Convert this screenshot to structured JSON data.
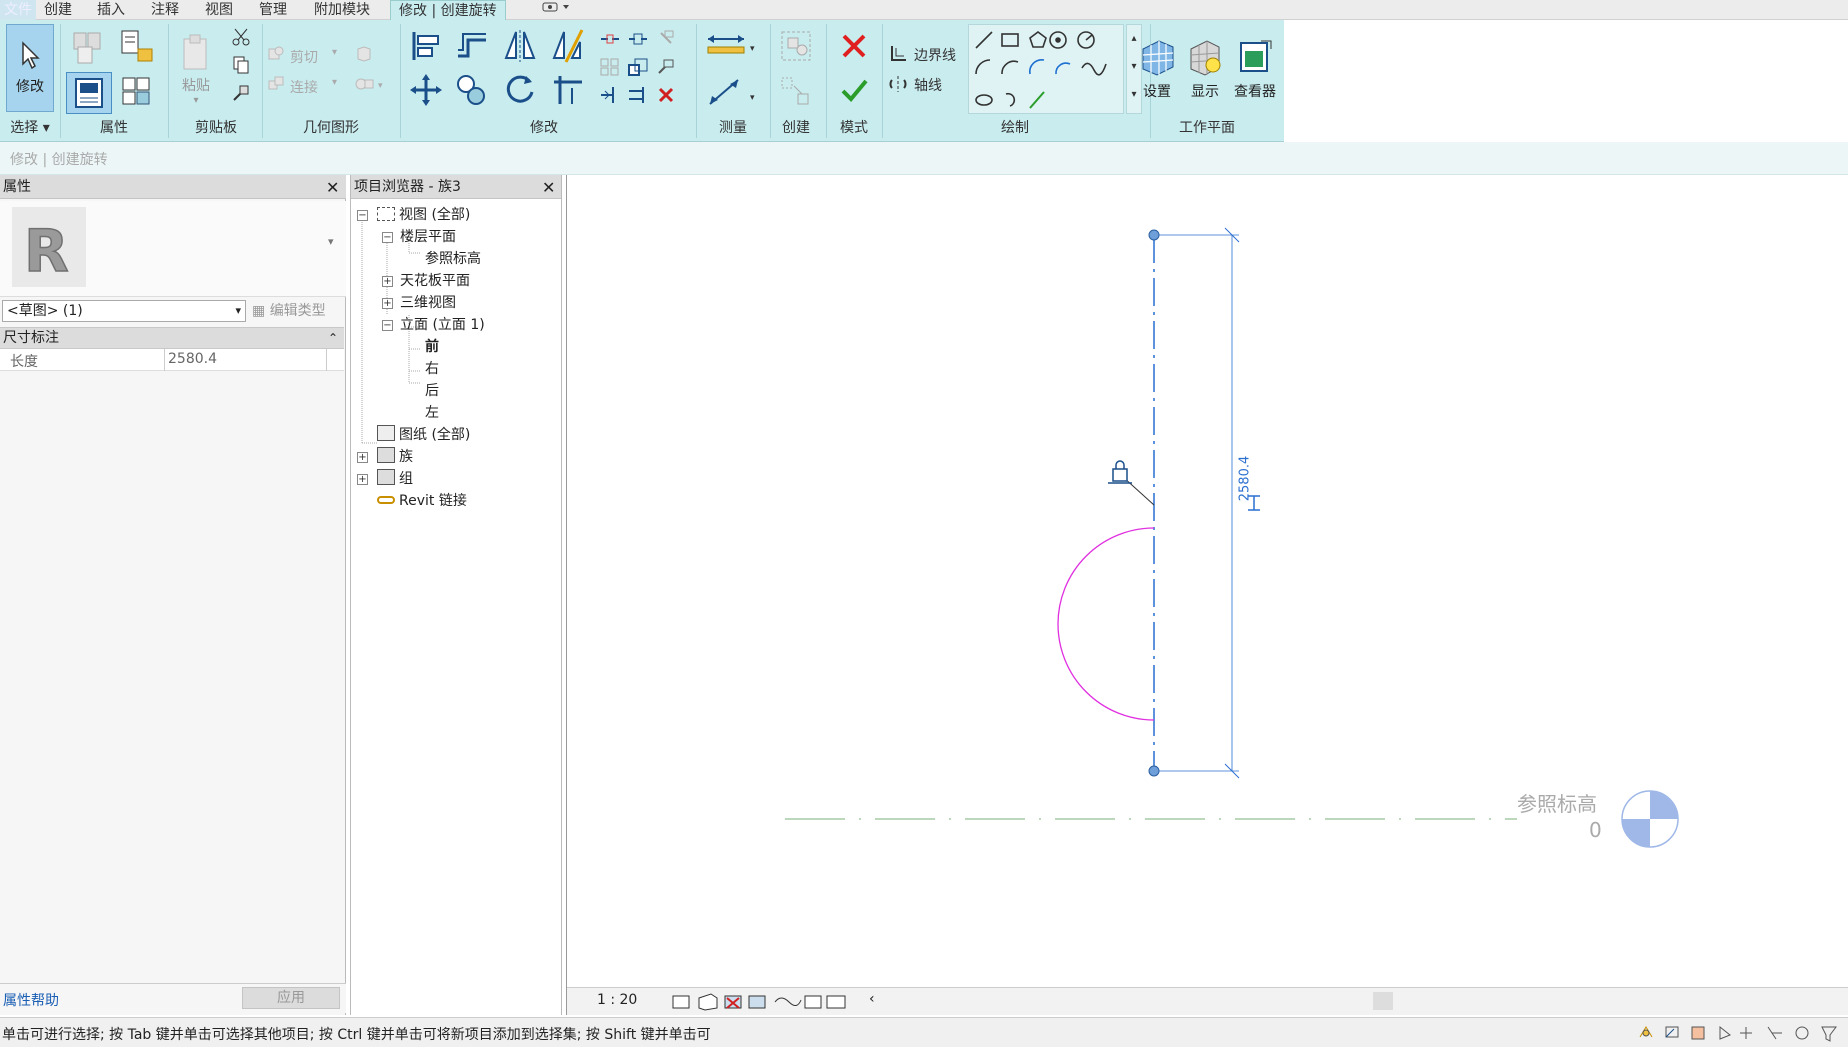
{
  "menubar": {
    "items": [
      "文件",
      "创建",
      "插入",
      "注释",
      "视图",
      "管理",
      "附加模块",
      "修改 | 创建旋转"
    ],
    "quick_icon": "view-toggle-icon"
  },
  "ribbon": {
    "panels": {
      "select": "选择",
      "properties": "属性",
      "clipboard": "剪贴板",
      "geometry": "几何图形",
      "modify": "修改",
      "measure": "测量",
      "create": "创建",
      "mode": "模式",
      "draw": "绘制",
      "workplane": "工作平面"
    },
    "buttons": {
      "modify": "修改",
      "paste": "粘贴",
      "cut": "剪切",
      "join": "连接",
      "boundary_line": "边界线",
      "axis_line": "轴线",
      "set": "设置",
      "show": "显示",
      "viewer": "查看器"
    }
  },
  "subbar": {
    "text": "修改 | 创建旋转"
  },
  "properties_panel": {
    "title": "属性",
    "type_selector": "<草图> (1)",
    "edit_type": "编辑类型",
    "section": "尺寸标注",
    "rows": [
      {
        "label": "长度",
        "value": "2580.4"
      }
    ],
    "help_link": "属性帮助",
    "apply": "应用"
  },
  "browser_panel": {
    "title": "项目浏览器 - 族3",
    "items": {
      "views_all": "视图 (全部)",
      "floor_plans": "楼层平面",
      "ref_level": "参照标高",
      "ceiling_plans": "天花板平面",
      "views_3d": "三维视图",
      "elevations": "立面 (立面 1)",
      "front": "前",
      "right": "右",
      "back": "后",
      "left": "左",
      "sheets": "图纸 (全部)",
      "families": "族",
      "groups": "组",
      "revit_links": "Revit 链接"
    }
  },
  "canvas": {
    "dimension_value": "2580.4",
    "level_name": "参照标高",
    "level_elevation": "0",
    "scale": "1 : 20"
  },
  "statusbar": {
    "text": "单击可进行选择; 按 Tab 键并单击可选择其他项目; 按 Ctrl 键并单击可将新项目添加到选择集; 按 Shift 键并单击可"
  },
  "colors": {
    "ribbon_bg": "#c9ecef",
    "sketch_arc": "#e030e0",
    "dimension": "#2060c0",
    "level_line": "#7ab07a"
  }
}
